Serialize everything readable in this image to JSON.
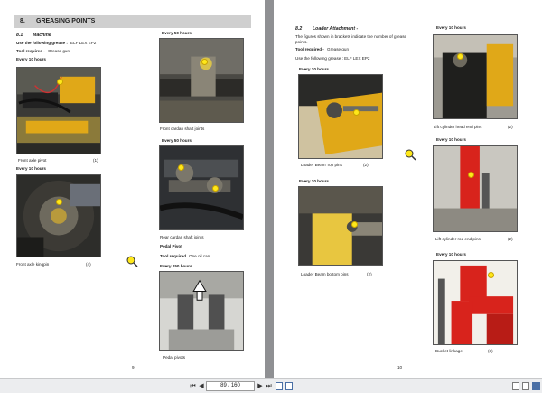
{
  "left_page": {
    "section_number": "8.",
    "section_title": "GREASING POINTS",
    "sub_number": "8.1",
    "sub_title": "Machine",
    "grease_label": "Use the following grease :",
    "grease_value": "ELF LEX EP2",
    "tool_label": "Tool required -",
    "tool_value": "Grease gun",
    "every_10_a": "Every 10 hours",
    "caption_front_axle": "Front axle pivot",
    "num_front_axle": "(1)",
    "every_10_b": "Every 10 hours",
    "caption_kingpin": "Front axle kingpin",
    "num_kingpin": "(4)",
    "every_50_a": "Every 50 hours",
    "caption_front_cardan": "Front cardan shaft joints",
    "every_50_b": "Every 50 hours",
    "caption_rear_cardan": "Rear cardan shaft joints",
    "pedal_pivot": "Pedal Pivot",
    "tool_label_2": "Tool required",
    "tool_value_2": "One oil can",
    "every_250": "Every 250 hours",
    "caption_pedal": "Pedal pivots",
    "page_number": "9"
  },
  "right_page": {
    "sub_number": "8.2",
    "sub_title": "Loader Attachment -",
    "intro_text": "The figures shown in brackets indicate the number of grease points.",
    "tool_label": "Tool required -",
    "tool_value": "Grease gun",
    "grease_text": "Use the following grease : ELF LEX EP2",
    "every_10_a": "Every 10 hours",
    "caption_top_pins": "Loader Beam Top pins",
    "num_top_pins": "(2)",
    "every_10_b": "Every 10 hours",
    "caption_bottom_pins": "Loader Beam bottom pins",
    "num_bottom_pins": "(2)",
    "every_10_c": "Every 10 hours",
    "caption_head_end": "Lift cylinder head end pins",
    "num_head_end": "(2)",
    "every_10_d": "Every 10 hours",
    "caption_rod_end": "Lift cylinder rod end pins",
    "num_rod_end": "(2)",
    "every_10_e": "Every 10 hours",
    "caption_bucket": "Bucket linkage",
    "num_bucket": "(3)",
    "page_number": "10"
  },
  "toolbar": {
    "page_indicator": "89 / 160",
    "first_label": "⏮",
    "prev_label": "◀",
    "next_label": "▶",
    "last_label": "⏭"
  },
  "colors": {
    "grease_dot": "#ffe81a",
    "machine_yellow": "#e0a818",
    "machine_red": "#d8231c",
    "section_bar": "#cfcfcf",
    "viewer_background": "#8f9093"
  }
}
